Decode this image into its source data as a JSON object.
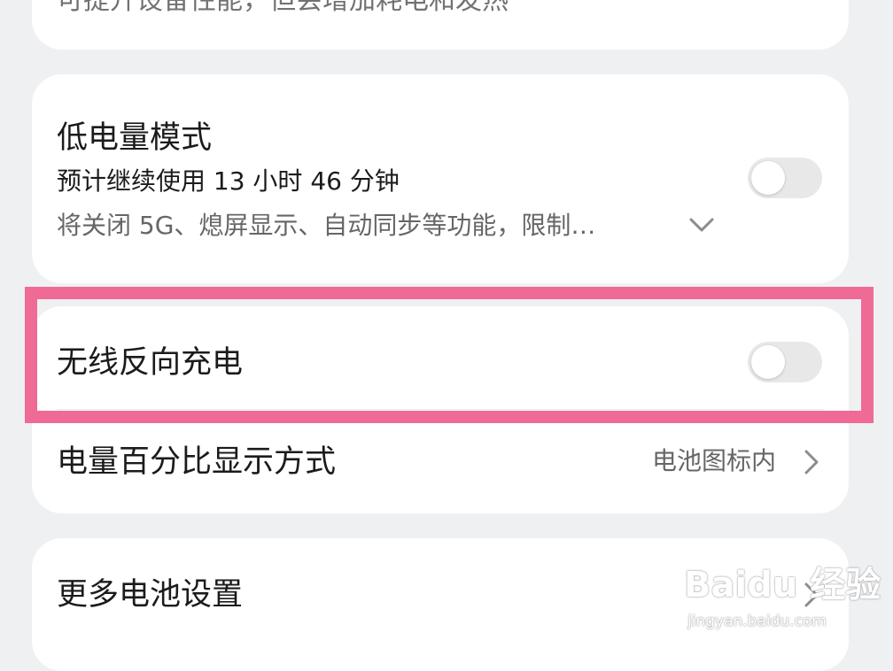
{
  "top_card": {
    "cut_text": "可提升设备性能，但会增加耗电和发热"
  },
  "power_saving": {
    "title": "低电量模式",
    "estimate": "预计继续使用 13 小时 46 分钟",
    "description": "将关闭 5G、熄屏显示、自动同步等功能，限制…",
    "toggle_on": false
  },
  "wireless_reverse_charging": {
    "title": "无线反向充电",
    "toggle_on": false
  },
  "battery_percentage": {
    "title": "电量百分比显示方式",
    "value": "电池图标内"
  },
  "more_battery_settings": {
    "title": "更多电池设置"
  },
  "annotation": {
    "highlight_color": "#f06a96"
  },
  "watermark": {
    "brand": "Baidu 经验",
    "url": "jingyan.baidu.com"
  },
  "colors": {
    "background": "#eff0f2",
    "card": "#ffffff",
    "toggle_off": "#e8e8e8"
  }
}
